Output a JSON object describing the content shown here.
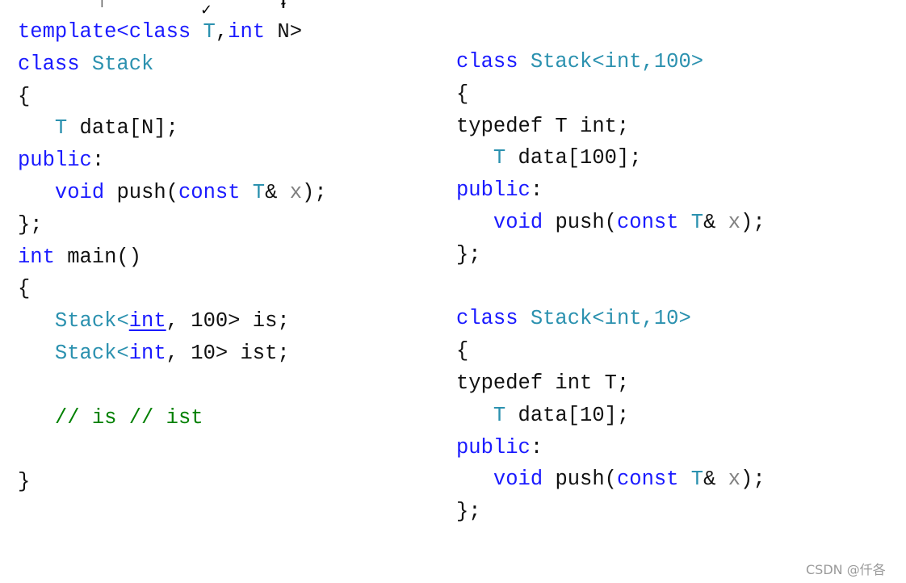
{
  "colors": {
    "keyword": "#1a1aff",
    "type": "#2b91af",
    "parameter": "#808080",
    "comment": "#008000",
    "text": "#111111"
  },
  "left_code": [
    [
      {
        "t": "template<class ",
        "c": "kw"
      },
      {
        "t": "T",
        "c": "ty"
      },
      {
        "t": ",",
        "c": "tx"
      },
      {
        "t": "int ",
        "c": "kw"
      },
      {
        "t": "N>",
        "c": "tx"
      }
    ],
    [
      {
        "t": "class ",
        "c": "kw"
      },
      {
        "t": "Stack",
        "c": "ty"
      }
    ],
    [
      {
        "t": "{",
        "c": "tx"
      }
    ],
    [
      {
        "t": "   ",
        "c": "tx"
      },
      {
        "t": "T",
        "c": "ty"
      },
      {
        "t": " data[N];",
        "c": "tx"
      }
    ],
    [
      {
        "t": "public",
        "c": "kw"
      },
      {
        "t": ":",
        "c": "tx"
      }
    ],
    [
      {
        "t": "   ",
        "c": "tx"
      },
      {
        "t": "void",
        "c": "kw"
      },
      {
        "t": " push(",
        "c": "tx"
      },
      {
        "t": "const ",
        "c": "kw"
      },
      {
        "t": "T",
        "c": "ty"
      },
      {
        "t": "& ",
        "c": "tx"
      },
      {
        "t": "x",
        "c": "pm"
      },
      {
        "t": ");",
        "c": "tx"
      }
    ],
    [
      {
        "t": "};",
        "c": "tx"
      }
    ],
    [
      {
        "t": "int",
        "c": "kw"
      },
      {
        "t": " main()",
        "c": "tx"
      }
    ],
    [
      {
        "t": "{",
        "c": "tx"
      }
    ],
    [
      {
        "t": "   ",
        "c": "tx"
      },
      {
        "t": "Stack",
        "c": "ty"
      },
      {
        "t": "<",
        "c": "ty"
      },
      {
        "t": "int",
        "c": "kw ul"
      },
      {
        "t": ", 100> is;",
        "c": "tx"
      }
    ],
    [
      {
        "t": "   ",
        "c": "tx"
      },
      {
        "t": "Stack<",
        "c": "ty"
      },
      {
        "t": "int",
        "c": "kw"
      },
      {
        "t": ", 10> ist;",
        "c": "tx"
      }
    ],
    [
      {
        "t": " ",
        "c": "tx"
      }
    ],
    [
      {
        "t": "   ",
        "c": "tx"
      },
      {
        "t": "// is // ist",
        "c": "cm"
      }
    ],
    [
      {
        "t": " ",
        "c": "tx"
      }
    ],
    [
      {
        "t": "}",
        "c": "tx"
      }
    ]
  ],
  "right_code": [
    [
      {
        "t": "class ",
        "c": "kw"
      },
      {
        "t": "Stack<int,100>",
        "c": "ty"
      }
    ],
    [
      {
        "t": "{",
        "c": "tx"
      }
    ],
    [
      {
        "t": "typedef T int;",
        "c": "tx"
      }
    ],
    [
      {
        "t": "   ",
        "c": "tx"
      },
      {
        "t": "T",
        "c": "ty"
      },
      {
        "t": " data[100];",
        "c": "tx"
      }
    ],
    [
      {
        "t": "public",
        "c": "kw"
      },
      {
        "t": ":",
        "c": "tx"
      }
    ],
    [
      {
        "t": "   ",
        "c": "tx"
      },
      {
        "t": "void",
        "c": "kw"
      },
      {
        "t": " push(",
        "c": "tx"
      },
      {
        "t": "const ",
        "c": "kw"
      },
      {
        "t": "T",
        "c": "ty"
      },
      {
        "t": "& ",
        "c": "tx"
      },
      {
        "t": "x",
        "c": "pm"
      },
      {
        "t": ");",
        "c": "tx"
      }
    ],
    [
      {
        "t": "};",
        "c": "tx"
      }
    ],
    [
      {
        "t": " ",
        "c": "tx"
      }
    ],
    [
      {
        "t": "class ",
        "c": "kw"
      },
      {
        "t": "Stack<int,10>",
        "c": "ty"
      }
    ],
    [
      {
        "t": "{",
        "c": "tx"
      }
    ],
    [
      {
        "t": "typedef int T;",
        "c": "tx"
      }
    ],
    [
      {
        "t": "   ",
        "c": "tx"
      },
      {
        "t": "T",
        "c": "ty"
      },
      {
        "t": " data[10];",
        "c": "tx"
      }
    ],
    [
      {
        "t": "public",
        "c": "kw"
      },
      {
        "t": ":",
        "c": "tx"
      }
    ],
    [
      {
        "t": "   ",
        "c": "tx"
      },
      {
        "t": "void",
        "c": "kw"
      },
      {
        "t": " push(",
        "c": "tx"
      },
      {
        "t": "const ",
        "c": "kw"
      },
      {
        "t": "T",
        "c": "ty"
      },
      {
        "t": "& ",
        "c": "tx"
      },
      {
        "t": "x",
        "c": "pm"
      },
      {
        "t": ");",
        "c": "tx"
      }
    ],
    [
      {
        "t": "};",
        "c": "tx"
      }
    ]
  ],
  "watermark": "CSDN @仟各"
}
